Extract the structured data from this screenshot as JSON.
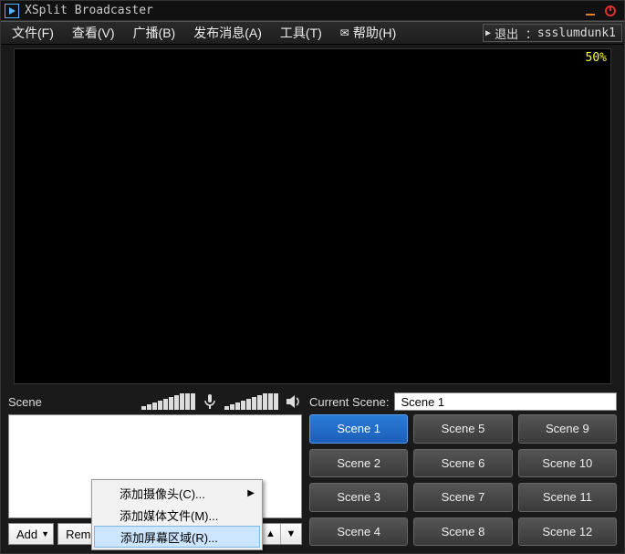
{
  "titlebar": {
    "app_title": "XSplit Broadcaster"
  },
  "menu": {
    "file": "文件(F)",
    "view": "查看(V)",
    "broadcast": "广播(B)",
    "publish": "发布消息(A)",
    "tools": "工具(T)",
    "help": "帮助(H)",
    "logout_prefix": "退出 ：",
    "username": "ssslumdunk1"
  },
  "preview": {
    "zoom": "50%"
  },
  "scene_panel": {
    "label": "Scene",
    "add_label": "Add",
    "remove_label": "Remove"
  },
  "context_menu": {
    "items": [
      {
        "label": "添加摄像头(C)...",
        "has_sub": true,
        "highlight": false
      },
      {
        "label": "添加媒体文件(M)...",
        "has_sub": false,
        "highlight": false
      },
      {
        "label": "添加屏幕区域(R)...",
        "has_sub": false,
        "highlight": true
      }
    ]
  },
  "current_scene": {
    "label": "Current Scene:",
    "value": "Scene 1"
  },
  "scenes": [
    {
      "label": "Scene 1",
      "active": true
    },
    {
      "label": "Scene 2",
      "active": false
    },
    {
      "label": "Scene 3",
      "active": false
    },
    {
      "label": "Scene 4",
      "active": false
    },
    {
      "label": "Scene 5",
      "active": false
    },
    {
      "label": "Scene 6",
      "active": false
    },
    {
      "label": "Scene 7",
      "active": false
    },
    {
      "label": "Scene 8",
      "active": false
    },
    {
      "label": "Scene 9",
      "active": false
    },
    {
      "label": "Scene 10",
      "active": false
    },
    {
      "label": "Scene 11",
      "active": false
    },
    {
      "label": "Scene 12",
      "active": false
    }
  ]
}
